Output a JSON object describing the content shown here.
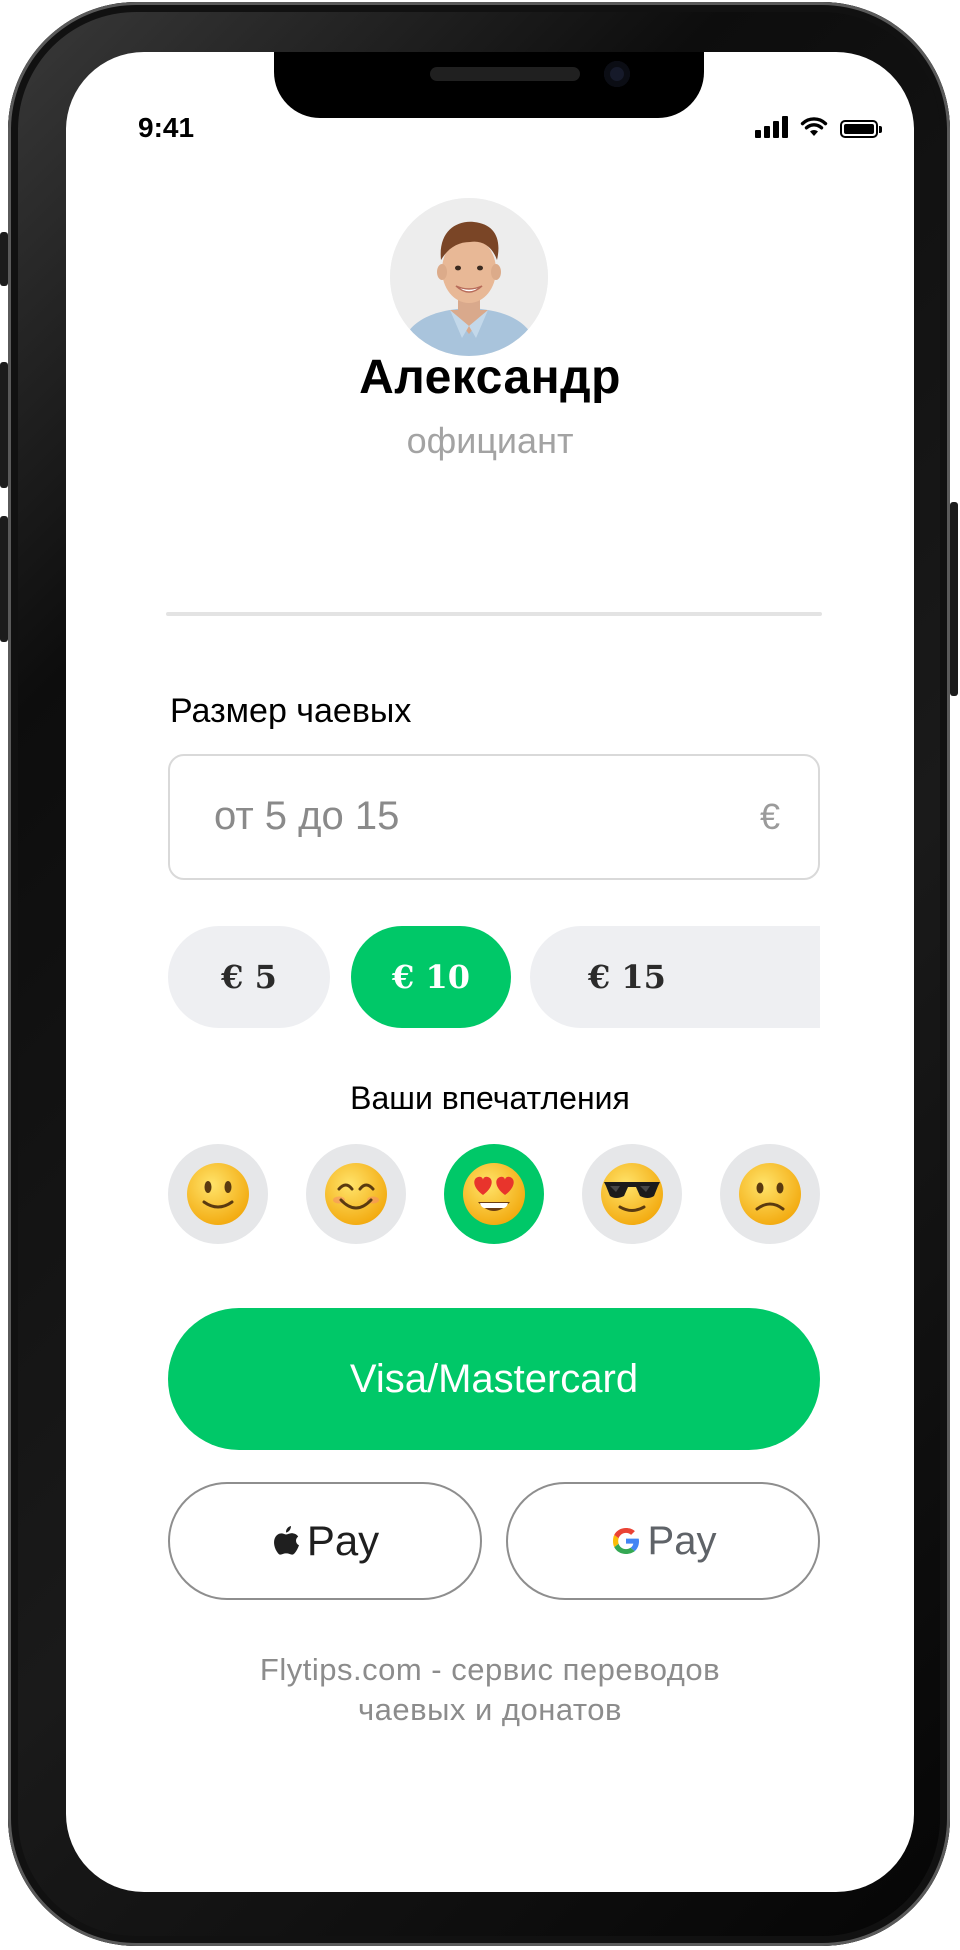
{
  "status_bar": {
    "time": "9:41"
  },
  "profile": {
    "name": "Александр",
    "role": "официант"
  },
  "tip": {
    "label": "Размер чаевых",
    "input_placeholder": "от 5 до 15",
    "currency_symbol": "€",
    "presets": [
      {
        "label": "€ 5",
        "selected": false
      },
      {
        "label": "€ 10",
        "selected": true
      },
      {
        "label": "€ 15",
        "selected": false
      }
    ]
  },
  "impressions": {
    "label": "Ваши впечатления",
    "options": [
      {
        "icon": "slight-smile-emoji-icon",
        "selected": false
      },
      {
        "icon": "smiling-eyes-emoji-icon",
        "selected": false
      },
      {
        "icon": "heart-eyes-emoji-icon",
        "selected": true
      },
      {
        "icon": "sunglasses-emoji-icon",
        "selected": false
      },
      {
        "icon": "slight-frown-emoji-icon",
        "selected": false
      }
    ]
  },
  "payment": {
    "card_label": "Visa/Mastercard",
    "apple_pay_label": "Pay",
    "google_pay_label": "Pay"
  },
  "footer": {
    "line1": "Flytips.com - сервис переводов",
    "line2": "чаевых и донатов"
  },
  "colors": {
    "accent": "#00c868",
    "chip_bg": "#eeeff2",
    "muted_text": "#a3a3a3"
  }
}
